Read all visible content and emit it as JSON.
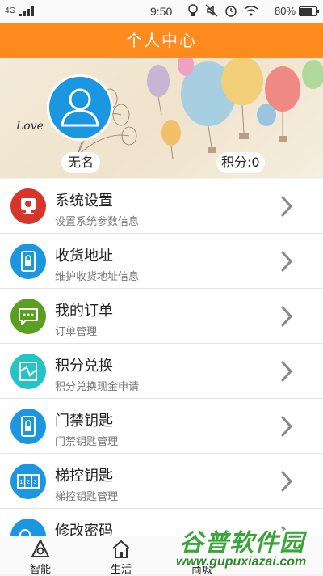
{
  "status_bar": {
    "network": "4G",
    "time": "9:50",
    "battery_percent": "80%",
    "battery_level": 0.8
  },
  "header": {
    "title": "个人中心"
  },
  "banner": {
    "love_text": "Love",
    "username": "无名",
    "points_label": "积分:",
    "points_value": "0"
  },
  "menu": {
    "items": [
      {
        "title": "系统设置",
        "subtitle": "设置系统参数信息",
        "icon": "settings-icon",
        "color": "#d8352a"
      },
      {
        "title": "收货地址",
        "subtitle": "维护收货地址信息",
        "icon": "lock-icon",
        "color": "#1a97e0"
      },
      {
        "title": "我的订单",
        "subtitle": "订单管理",
        "icon": "chat-icon",
        "color": "#5aa01e"
      },
      {
        "title": "积分兑换",
        "subtitle": "积分兑换现金申请",
        "icon": "map-icon",
        "color": "#22c4c4"
      },
      {
        "title": "门禁钥匙",
        "subtitle": "门禁钥匙管理",
        "icon": "lock-icon",
        "color": "#1a97e0"
      },
      {
        "title": "梯控钥匙",
        "subtitle": "梯控钥匙管理",
        "icon": "elevator-icon",
        "color": "#1a97e0"
      },
      {
        "title": "修改密码",
        "subtitle": "",
        "icon": "key-icon",
        "color": "#1a97e0"
      }
    ]
  },
  "tab_bar": {
    "tabs": [
      {
        "label": "智能",
        "icon": "smart-icon"
      },
      {
        "label": "生活",
        "icon": "home-icon"
      },
      {
        "label": "商城",
        "icon": "store-icon"
      }
    ]
  },
  "watermark": {
    "title": "谷普软件园",
    "url": "www.gupuxiazai.com"
  }
}
